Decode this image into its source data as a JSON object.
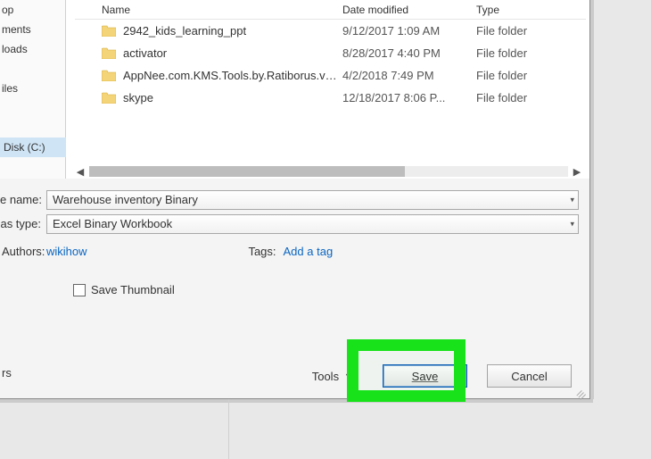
{
  "nav": {
    "items": [
      "op",
      "ments",
      "loads"
    ],
    "mid": [
      "iles"
    ],
    "selected": "Disk (C:)"
  },
  "columns": {
    "name": "Name",
    "date": "Date modified",
    "type": "Type"
  },
  "files": [
    {
      "name": "2942_kids_learning_ppt",
      "date": "9/12/2017 1:09 AM",
      "type": "File folder"
    },
    {
      "name": "activator",
      "date": "8/28/2017 4:40 PM",
      "type": "File folder"
    },
    {
      "name": "AppNee.com.KMS.Tools.by.Ratiborus.v20...",
      "date": "4/2/2018 7:49 PM",
      "type": "File folder"
    },
    {
      "name": "skype",
      "date": "12/18/2017 8:06 P...",
      "type": "File folder"
    }
  ],
  "fields": {
    "filename_label": "e name:",
    "filename_value": "Warehouse inventory Binary",
    "filetype_label": "as type:",
    "filetype_value": "Excel Binary Workbook"
  },
  "meta": {
    "authors_label": "Authors:",
    "authors_value": "wikihow",
    "tags_label": "Tags:",
    "tags_value": "Add a tag"
  },
  "thumb": {
    "label": "Save Thumbnail"
  },
  "buttons": {
    "tools": "Tools",
    "save": "Save",
    "cancel": "Cancel"
  },
  "footer_label": "rs"
}
